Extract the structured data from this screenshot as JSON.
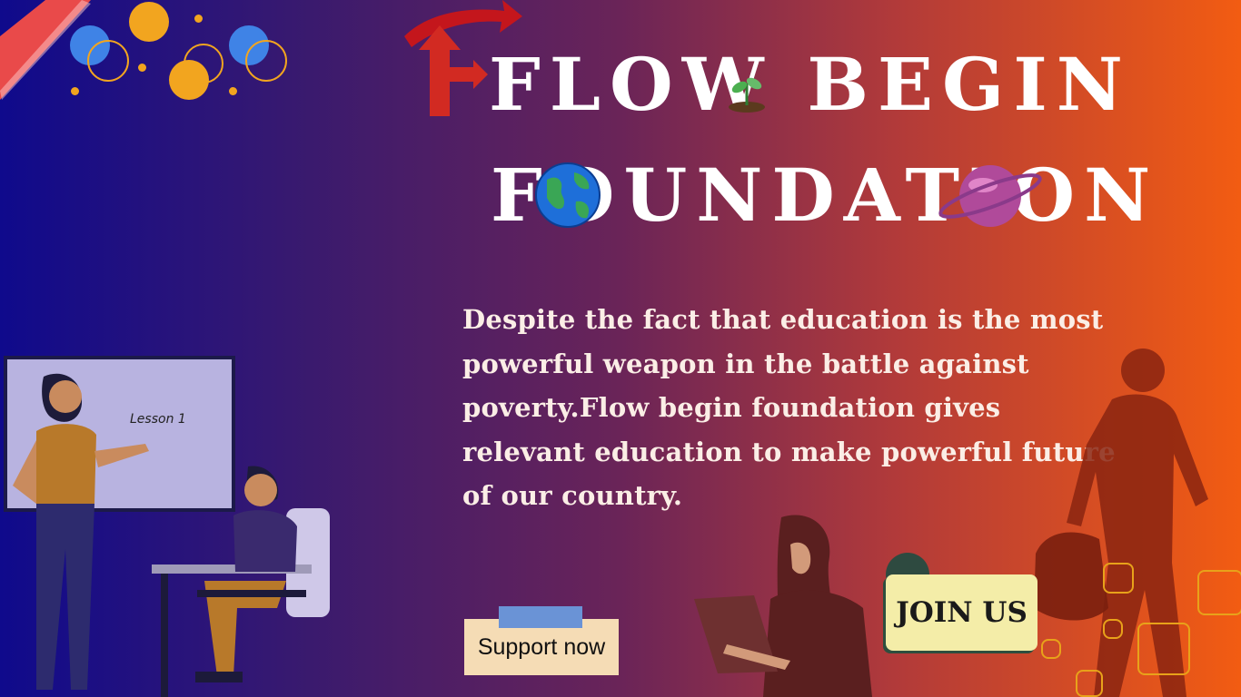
{
  "title": {
    "line1": "FLOW BEGIN",
    "line2": "FOUNDATION"
  },
  "body": {
    "text": "Despite the fact that education is the most powerful weapon in the battle against poverty.Flow begin foundation gives relevant education to make powerful future of our country."
  },
  "buttons": {
    "support_label": "Support now",
    "join_label": "JOIN US"
  },
  "whiteboard": {
    "label": "Lesson 1"
  },
  "icons": [
    "arrow-icon",
    "sprout-icon",
    "earth-globe-icon",
    "planet-icon",
    "ribbon-icon"
  ],
  "colors": {
    "gradient_left": "#0f0a8c",
    "gradient_right": "#f25c12",
    "support_bg": "#f5dcb5",
    "join_bg": "#f4eda8",
    "accent_yellow": "#f2a51f"
  }
}
